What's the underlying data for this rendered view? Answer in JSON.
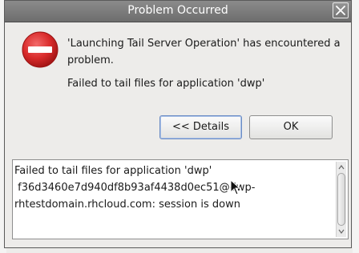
{
  "window": {
    "title": "Problem Occurred"
  },
  "message": {
    "headline": "'Launching Tail Server Operation' has encountered a problem.",
    "detail": "Failed to tail files for application 'dwp'"
  },
  "buttons": {
    "details_label": "<< Details",
    "ok_label": "OK"
  },
  "details": {
    "text": "Failed to tail files for application 'dwp'\n f36d3460e7d940df8b93af4438d0ec51@dwp-\nrhtestdomain.rhcloud.com: session is down"
  },
  "icons": {
    "error": "error-icon",
    "close": "close-icon"
  },
  "colors": {
    "error_red": "#d92b2b",
    "titlebar": "#7d7d7d",
    "focus_border": "#6b8cc4"
  }
}
